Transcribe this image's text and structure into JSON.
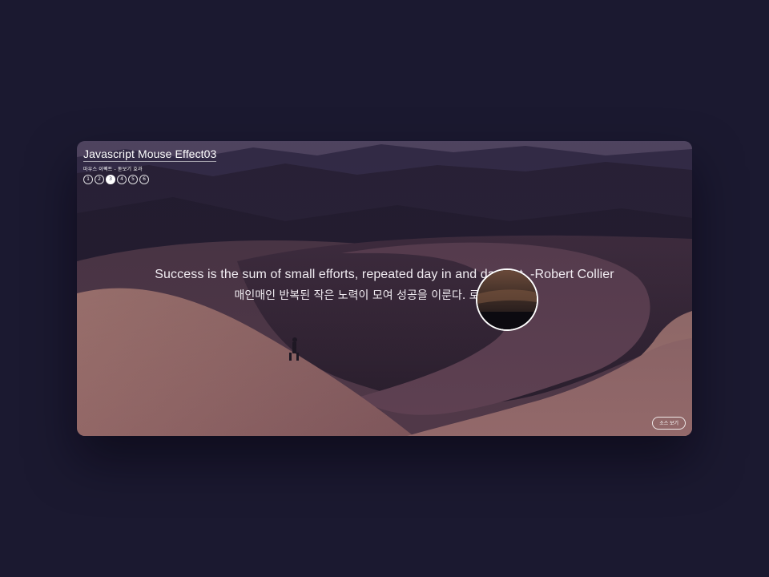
{
  "header": {
    "title": "Javascript Mouse Effect03",
    "subtitle": "마우스 이펙트 - 돋보기 효과"
  },
  "pager": {
    "pages": [
      "1",
      "2",
      "3",
      "4",
      "5",
      "6"
    ],
    "active": "3"
  },
  "quote": {
    "english": "Success is the sum of small efforts, repeated day in and day out. -Robert Collier",
    "korean": "매인매인 반복된 작은 노력이 모여 성공을 이룬다. 로버트 콜리어"
  },
  "source_button": {
    "label": "소스 보기"
  },
  "colors": {
    "page_background": "#1b1930",
    "text": "#ffffff",
    "sand": "#b9847a",
    "shadow_sand": "#3a2635"
  }
}
